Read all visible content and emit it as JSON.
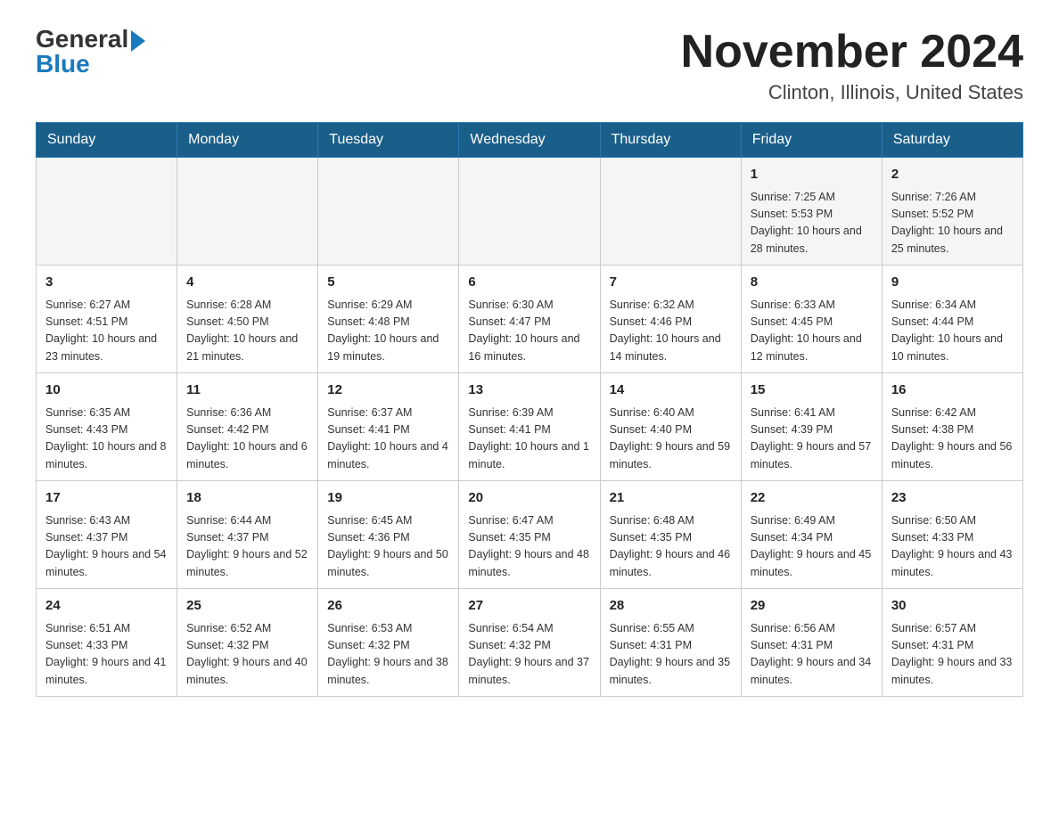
{
  "logo": {
    "general": "General",
    "blue": "Blue"
  },
  "title": "November 2024",
  "location": "Clinton, Illinois, United States",
  "weekdays": [
    "Sunday",
    "Monday",
    "Tuesday",
    "Wednesday",
    "Thursday",
    "Friday",
    "Saturday"
  ],
  "weeks": [
    [
      {
        "day": "",
        "info": ""
      },
      {
        "day": "",
        "info": ""
      },
      {
        "day": "",
        "info": ""
      },
      {
        "day": "",
        "info": ""
      },
      {
        "day": "",
        "info": ""
      },
      {
        "day": "1",
        "info": "Sunrise: 7:25 AM\nSunset: 5:53 PM\nDaylight: 10 hours and 28 minutes."
      },
      {
        "day": "2",
        "info": "Sunrise: 7:26 AM\nSunset: 5:52 PM\nDaylight: 10 hours and 25 minutes."
      }
    ],
    [
      {
        "day": "3",
        "info": "Sunrise: 6:27 AM\nSunset: 4:51 PM\nDaylight: 10 hours and 23 minutes."
      },
      {
        "day": "4",
        "info": "Sunrise: 6:28 AM\nSunset: 4:50 PM\nDaylight: 10 hours and 21 minutes."
      },
      {
        "day": "5",
        "info": "Sunrise: 6:29 AM\nSunset: 4:48 PM\nDaylight: 10 hours and 19 minutes."
      },
      {
        "day": "6",
        "info": "Sunrise: 6:30 AM\nSunset: 4:47 PM\nDaylight: 10 hours and 16 minutes."
      },
      {
        "day": "7",
        "info": "Sunrise: 6:32 AM\nSunset: 4:46 PM\nDaylight: 10 hours and 14 minutes."
      },
      {
        "day": "8",
        "info": "Sunrise: 6:33 AM\nSunset: 4:45 PM\nDaylight: 10 hours and 12 minutes."
      },
      {
        "day": "9",
        "info": "Sunrise: 6:34 AM\nSunset: 4:44 PM\nDaylight: 10 hours and 10 minutes."
      }
    ],
    [
      {
        "day": "10",
        "info": "Sunrise: 6:35 AM\nSunset: 4:43 PM\nDaylight: 10 hours and 8 minutes."
      },
      {
        "day": "11",
        "info": "Sunrise: 6:36 AM\nSunset: 4:42 PM\nDaylight: 10 hours and 6 minutes."
      },
      {
        "day": "12",
        "info": "Sunrise: 6:37 AM\nSunset: 4:41 PM\nDaylight: 10 hours and 4 minutes."
      },
      {
        "day": "13",
        "info": "Sunrise: 6:39 AM\nSunset: 4:41 PM\nDaylight: 10 hours and 1 minute."
      },
      {
        "day": "14",
        "info": "Sunrise: 6:40 AM\nSunset: 4:40 PM\nDaylight: 9 hours and 59 minutes."
      },
      {
        "day": "15",
        "info": "Sunrise: 6:41 AM\nSunset: 4:39 PM\nDaylight: 9 hours and 57 minutes."
      },
      {
        "day": "16",
        "info": "Sunrise: 6:42 AM\nSunset: 4:38 PM\nDaylight: 9 hours and 56 minutes."
      }
    ],
    [
      {
        "day": "17",
        "info": "Sunrise: 6:43 AM\nSunset: 4:37 PM\nDaylight: 9 hours and 54 minutes."
      },
      {
        "day": "18",
        "info": "Sunrise: 6:44 AM\nSunset: 4:37 PM\nDaylight: 9 hours and 52 minutes."
      },
      {
        "day": "19",
        "info": "Sunrise: 6:45 AM\nSunset: 4:36 PM\nDaylight: 9 hours and 50 minutes."
      },
      {
        "day": "20",
        "info": "Sunrise: 6:47 AM\nSunset: 4:35 PM\nDaylight: 9 hours and 48 minutes."
      },
      {
        "day": "21",
        "info": "Sunrise: 6:48 AM\nSunset: 4:35 PM\nDaylight: 9 hours and 46 minutes."
      },
      {
        "day": "22",
        "info": "Sunrise: 6:49 AM\nSunset: 4:34 PM\nDaylight: 9 hours and 45 minutes."
      },
      {
        "day": "23",
        "info": "Sunrise: 6:50 AM\nSunset: 4:33 PM\nDaylight: 9 hours and 43 minutes."
      }
    ],
    [
      {
        "day": "24",
        "info": "Sunrise: 6:51 AM\nSunset: 4:33 PM\nDaylight: 9 hours and 41 minutes."
      },
      {
        "day": "25",
        "info": "Sunrise: 6:52 AM\nSunset: 4:32 PM\nDaylight: 9 hours and 40 minutes."
      },
      {
        "day": "26",
        "info": "Sunrise: 6:53 AM\nSunset: 4:32 PM\nDaylight: 9 hours and 38 minutes."
      },
      {
        "day": "27",
        "info": "Sunrise: 6:54 AM\nSunset: 4:32 PM\nDaylight: 9 hours and 37 minutes."
      },
      {
        "day": "28",
        "info": "Sunrise: 6:55 AM\nSunset: 4:31 PM\nDaylight: 9 hours and 35 minutes."
      },
      {
        "day": "29",
        "info": "Sunrise: 6:56 AM\nSunset: 4:31 PM\nDaylight: 9 hours and 34 minutes."
      },
      {
        "day": "30",
        "info": "Sunrise: 6:57 AM\nSunset: 4:31 PM\nDaylight: 9 hours and 33 minutes."
      }
    ]
  ]
}
